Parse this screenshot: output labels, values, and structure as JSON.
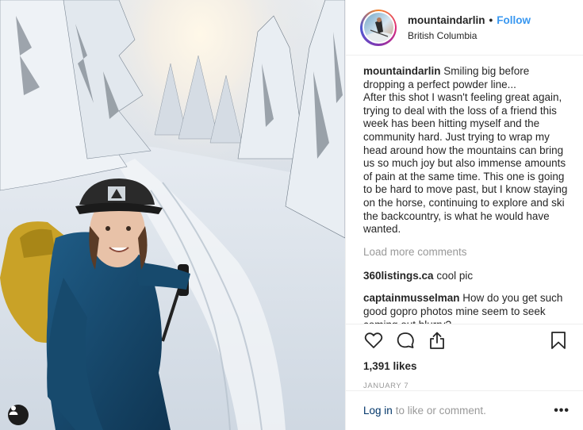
{
  "post": {
    "username": "mountaindarlin",
    "separator": "•",
    "follow_label": "Follow",
    "location": "British Columbia",
    "caption_user": "mountaindarlin",
    "caption_text": " Smiling big before dropping a perfect powder line...\nAfter this shot I wasn't feeling great again, trying to deal with the loss of a friend this week has been hitting myself and the community hard. Just trying to wrap my head around how the mountains can bring us so much joy but also immense amounts of pain at the same time. This one is going to be hard to move past, but I know staying on the horse, continuing to explore and ski the backcountry, is what he would have wanted.",
    "load_more_label": "Load more comments",
    "comments": [
      {
        "user": "360listings.ca",
        "text": " cool pic"
      },
      {
        "user": "captainmusselman",
        "text": " How do you get such good gopro photos mine seem to seek coming out blurry?"
      }
    ],
    "likes": "1,391 likes",
    "date": "JANUARY 7",
    "login_link": "Log in",
    "login_rest": "to like or comment.",
    "more_label": "•••"
  },
  "icons": {
    "like": "heart-outline-icon",
    "comment": "comment-bubble-icon",
    "share": "share-upload-icon",
    "save": "bookmark-icon",
    "user_tags": "person-icon"
  },
  "colors": {
    "accent": "#3897f0",
    "link": "#003569",
    "muted": "#999999",
    "text": "#262626"
  }
}
